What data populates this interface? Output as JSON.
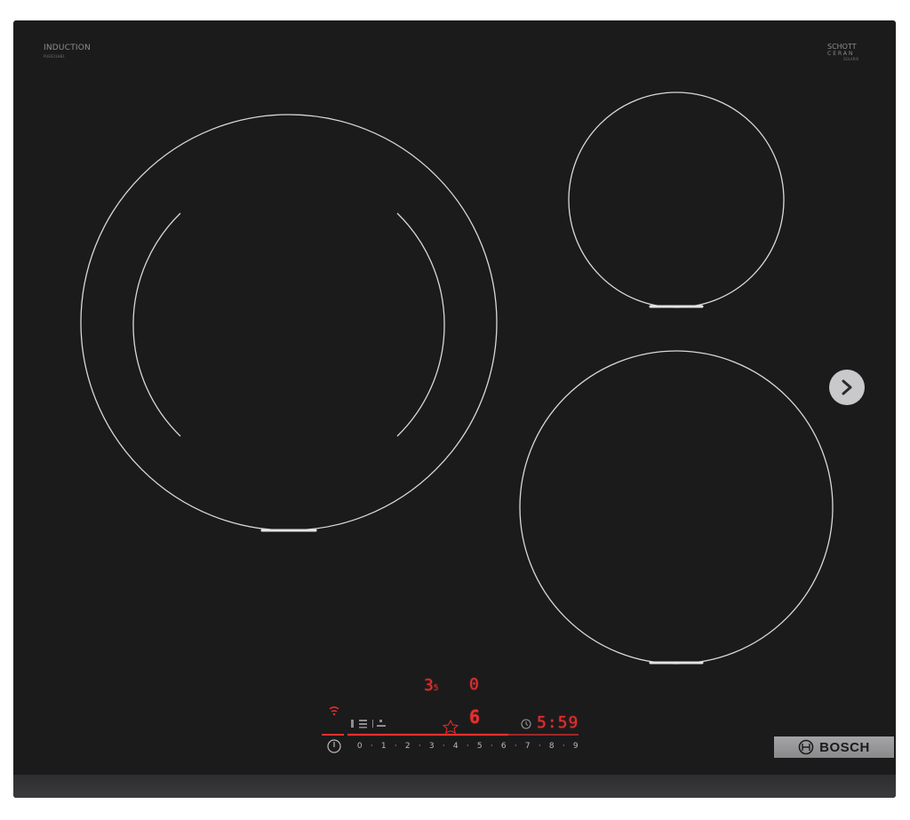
{
  "brand": {
    "induction_label": "INDUCTION",
    "model_code": "PUE631HB1",
    "glass_brand_line1": "SCHOTT",
    "glass_brand_line2": "CERAN",
    "glass_brand_sub": "SOLARIS",
    "maker": "BOSCH"
  },
  "display": {
    "zone_level_left": "3",
    "zone_level_left_sub": "5",
    "zone_level_right": "0",
    "boost_level": "6",
    "timer": "5:59",
    "power_scale": [
      "0",
      "·",
      "1",
      "·",
      "2",
      "·",
      "3",
      "·",
      "4",
      "·",
      "5",
      "·",
      "6",
      "·",
      "7",
      "·",
      "8",
      "·",
      "9"
    ]
  },
  "icons": {
    "power": "power-icon",
    "timer": "clock-icon",
    "favorite": "star-icon",
    "wifi": "wifi-icon",
    "next": "chevron-right-icon",
    "logo": "bosch-logo-icon"
  },
  "colors": {
    "glass": "#1b1b1c",
    "ring": "#d9d9db",
    "led": "#e8302f",
    "plate": "#9a9a9c"
  }
}
